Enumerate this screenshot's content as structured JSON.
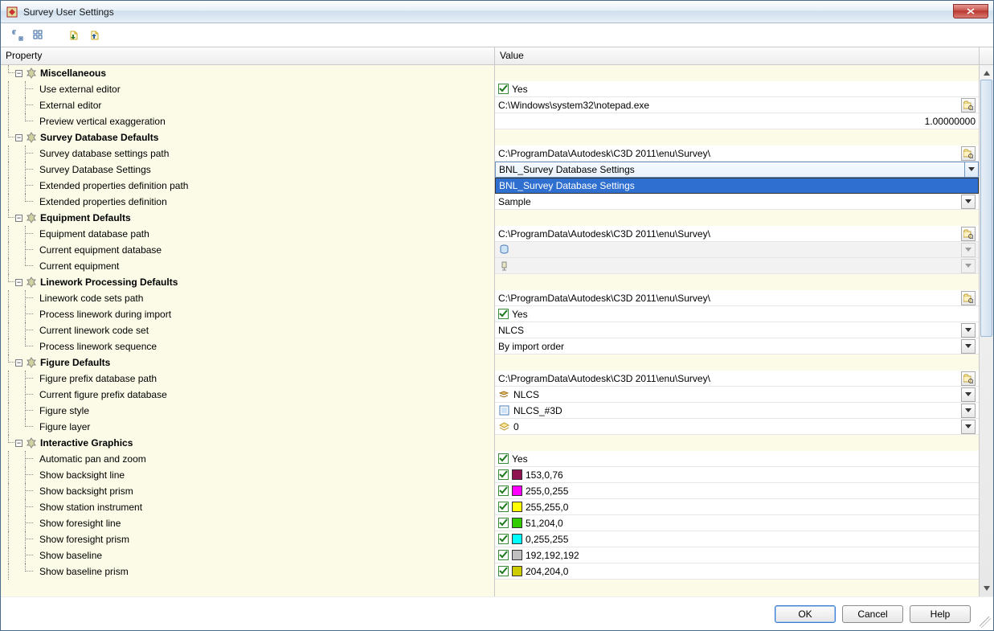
{
  "window": {
    "title": "Survey User Settings"
  },
  "headers": {
    "property": "Property",
    "value": "Value"
  },
  "footer": {
    "ok": "OK",
    "cancel": "Cancel",
    "help": "Help"
  },
  "dropdown": {
    "selected": "BNL_Survey Database Settings",
    "option": "BNL_Survey Database Settings"
  },
  "groups": {
    "misc": {
      "title": "Miscellaneous"
    },
    "dbdef": {
      "title": "Survey Database Defaults"
    },
    "equip": {
      "title": "Equipment Defaults"
    },
    "linework": {
      "title": "Linework Processing Defaults"
    },
    "figure": {
      "title": "Figure Defaults"
    },
    "ig": {
      "title": "Interactive Graphics"
    }
  },
  "misc": {
    "useExternal": {
      "label": "Use external editor",
      "value": "Yes"
    },
    "externalEditor": {
      "label": "External editor",
      "value": "C:\\Windows\\system32\\notepad.exe"
    },
    "prevExag": {
      "label": "Preview vertical exaggeration",
      "value": "1.00000000"
    }
  },
  "dbdef": {
    "dbSettingsPath": {
      "label": "Survey database settings path",
      "value": "C:\\ProgramData\\Autodesk\\C3D 2011\\enu\\Survey\\"
    },
    "dbSettings": {
      "label": "Survey Database Settings"
    },
    "extPropPath": {
      "label": "Extended properties definition path"
    },
    "extPropDef": {
      "label": "Extended properties definition",
      "value": "Sample"
    }
  },
  "equip": {
    "eqDbPath": {
      "label": "Equipment database path",
      "value": "C:\\ProgramData\\Autodesk\\C3D 2011\\enu\\Survey\\"
    },
    "curEqDb": {
      "label": "Current equipment database"
    },
    "curEq": {
      "label": "Current equipment"
    }
  },
  "linework": {
    "codeSetsPath": {
      "label": "Linework code sets path",
      "value": "C:\\ProgramData\\Autodesk\\C3D 2011\\enu\\Survey\\"
    },
    "processImport": {
      "label": "Process linework during import",
      "value": "Yes"
    },
    "curCodeSet": {
      "label": "Current linework code set",
      "value": "NLCS"
    },
    "seq": {
      "label": "Process linework sequence",
      "value": "By import order"
    }
  },
  "figure": {
    "prefixDbPath": {
      "label": "Figure prefix database path",
      "value": "C:\\ProgramData\\Autodesk\\C3D 2011\\enu\\Survey\\"
    },
    "curPrefixDb": {
      "label": "Current figure prefix database",
      "value": "NLCS"
    },
    "style": {
      "label": "Figure style",
      "value": "NLCS_#3D"
    },
    "layer": {
      "label": "Figure layer",
      "value": "0"
    }
  },
  "ig": {
    "autoPan": {
      "label": "Automatic pan and zoom",
      "value": "Yes"
    },
    "bsLine": {
      "label": "Show backsight line",
      "value": "153,0,76",
      "color": "#8e1350"
    },
    "bsPrism": {
      "label": "Show backsight prism",
      "value": "255,0,255",
      "color": "#ff00ff"
    },
    "stInstr": {
      "label": "Show station instrument",
      "value": "255,255,0",
      "color": "#ffff00"
    },
    "fsLine": {
      "label": "Show foresight line",
      "value": "51,204,0",
      "color": "#33cc00"
    },
    "fsPrism": {
      "label": "Show foresight prism",
      "value": "0,255,255",
      "color": "#00ffff"
    },
    "baseline": {
      "label": "Show baseline",
      "value": "192,192,192",
      "color": "#c0c0c0"
    },
    "blPrism": {
      "label": "Show baseline prism",
      "value": "204,204,0",
      "color": "#cccc00"
    }
  }
}
